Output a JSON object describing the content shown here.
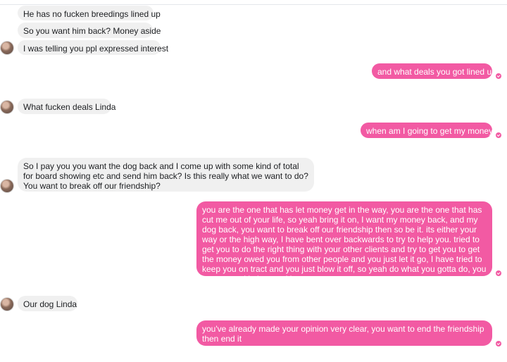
{
  "thread": {
    "messages": [
      {
        "from": "them",
        "text": "He has no fucken breedings lined up"
      },
      {
        "from": "them",
        "text": "So you want him back? Money aside"
      },
      {
        "from": "them",
        "text": "I was telling you ppl expressed interest"
      },
      {
        "from": "me",
        "text": "and what deals you got lined up"
      },
      {
        "from": "them",
        "text": "What fucken deals Linda"
      },
      {
        "from": "me",
        "text": "when am I going to get my money?"
      },
      {
        "from": "them",
        "text": "So I pay you you want the dog back and I come up with some kind of total for board showing etc and send him back? Is this really what we want to do? You want to break off our friendship?"
      },
      {
        "from": "me",
        "text": "you are the one that has let money get in the way, you are the one that has cut me out of your life, so yeah bring it on, I want my money back, and my dog back, you want to break off our friendship then so be it.  its either your way or the high way,  I have bent over backwards to try to help you. tried to get you to do the right thing with your other clients and try to get you to get the money owed you from other people and you just let it go, I have tried to keep you on tract and you just blow it off, so yeah do what you gotta do, you want to end it then end it"
      },
      {
        "from": "them",
        "text": "Our dog Linda"
      },
      {
        "from": "me",
        "text": "you've already made your opinion very clear, you want to end the friendship then end it"
      }
    ]
  },
  "colors": {
    "outgoing_bubble": "#f25aa3",
    "incoming_bubble": "#f0f0f0"
  }
}
